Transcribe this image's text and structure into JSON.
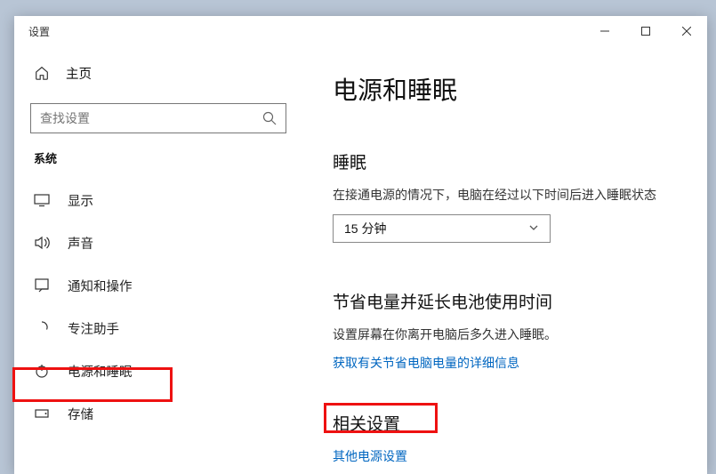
{
  "window": {
    "title": "设置"
  },
  "sidebar": {
    "home": "主页",
    "search_placeholder": "查找设置",
    "category": "系统",
    "items": [
      {
        "label": "显示",
        "icon": "display-icon"
      },
      {
        "label": "声音",
        "icon": "sound-icon"
      },
      {
        "label": "通知和操作",
        "icon": "notifications-icon"
      },
      {
        "label": "专注助手",
        "icon": "focus-icon"
      },
      {
        "label": "电源和睡眠",
        "icon": "power-icon"
      },
      {
        "label": "存储",
        "icon": "storage-icon"
      }
    ]
  },
  "content": {
    "heading": "电源和睡眠",
    "sleep": {
      "title": "睡眠",
      "desc": "在接通电源的情况下，电脑在经过以下时间后进入睡眠状态",
      "select_value": "15 分钟"
    },
    "save": {
      "title": "节省电量并延长电池使用时间",
      "desc": "设置屏幕在你离开电脑后多久进入睡眠。",
      "link": "获取有关节省电脑电量的详细信息"
    },
    "related": {
      "title": "相关设置",
      "link": "其他电源设置"
    }
  }
}
